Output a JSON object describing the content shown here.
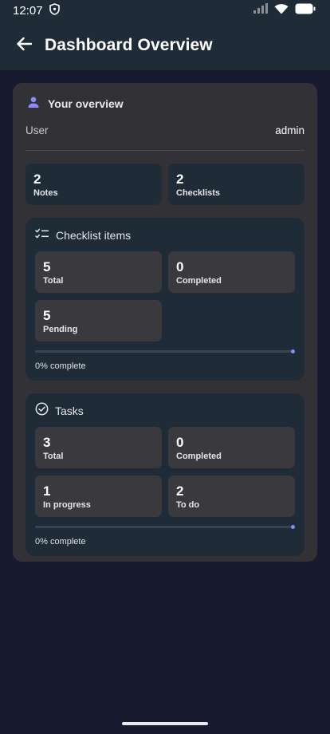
{
  "status_bar": {
    "time": "12:07"
  },
  "app_bar": {
    "title": "Dashboard Overview"
  },
  "overview": {
    "title": "Your overview",
    "user_label": "User",
    "user_value": "admin",
    "stats": [
      {
        "value": "2",
        "label": "Notes"
      },
      {
        "value": "2",
        "label": "Checklists"
      }
    ]
  },
  "checklist_items": {
    "title": "Checklist items",
    "stats": [
      {
        "value": "5",
        "label": "Total"
      },
      {
        "value": "0",
        "label": "Completed"
      },
      {
        "value": "5",
        "label": "Pending"
      }
    ],
    "progress": 0,
    "progress_text": "0% complete"
  },
  "tasks": {
    "title": "Tasks",
    "stats": [
      {
        "value": "3",
        "label": "Total"
      },
      {
        "value": "0",
        "label": "Completed"
      },
      {
        "value": "1",
        "label": "In progress"
      },
      {
        "value": "2",
        "label": "To do"
      }
    ],
    "progress": 0,
    "progress_text": "0% complete"
  },
  "colors": {
    "background": "#181a30",
    "app_bar": "#1f2b37",
    "card": "#323236",
    "accent": "#8b8bff"
  }
}
